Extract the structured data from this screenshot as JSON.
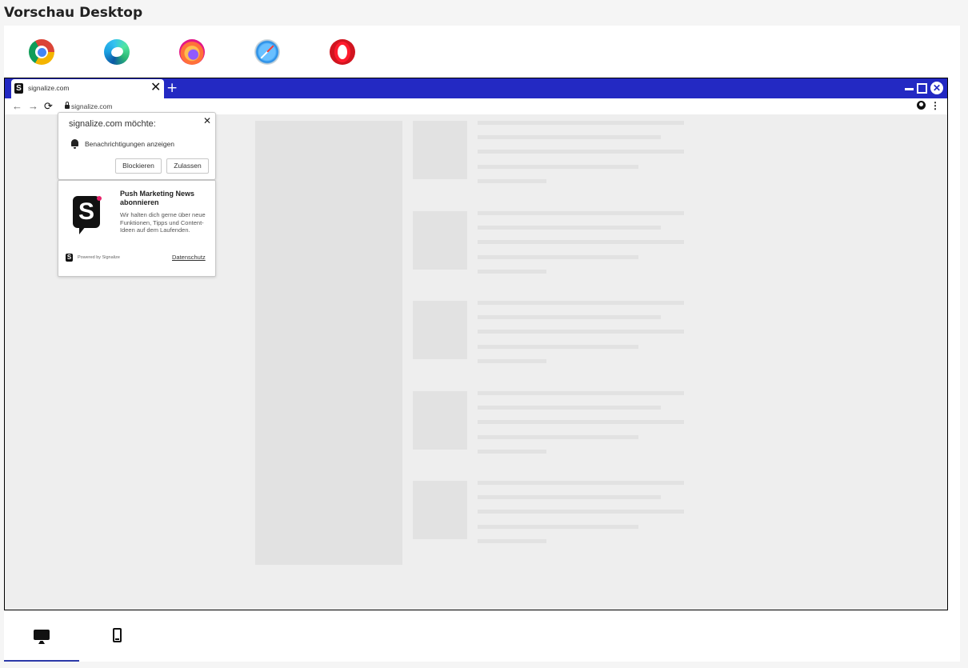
{
  "page": {
    "title": "Vorschau Desktop"
  },
  "browser_tabs": [
    {
      "name": "Chrome",
      "icon": "chrome-icon",
      "active": true
    },
    {
      "name": "Edge",
      "icon": "edge-icon",
      "active": false
    },
    {
      "name": "Firefox",
      "icon": "firefox-icon",
      "active": false
    },
    {
      "name": "Safari",
      "icon": "safari-icon",
      "active": false
    },
    {
      "name": "Opera",
      "icon": "opera-icon",
      "active": false
    }
  ],
  "browser": {
    "tab_title": "signalize.com",
    "tab_close": "✕",
    "new_tab": "+",
    "url": "signalize.com",
    "titlebar_color": "#2329c3"
  },
  "permission_prompt": {
    "title": "signalize.com möchte:",
    "close": "✕",
    "text": "Benachrichtigungen anzeigen",
    "block_label": "Blockieren",
    "allow_label": "Zulassen"
  },
  "signup_card": {
    "logo_letter": "S",
    "title": "Push Marketing News abonnieren",
    "text": "Wir halten dich gerne über neue Funktionen, Tipps und Content-Ideen auf dem Laufenden.",
    "powered": "Powered by Signalize",
    "privacy": "Datenschutz",
    "accent_color": "#e8236b"
  },
  "device_tabs": [
    {
      "name": "Desktop",
      "icon": "desktop-icon",
      "active": true
    },
    {
      "name": "Mobile",
      "icon": "mobile-icon",
      "active": false
    }
  ]
}
